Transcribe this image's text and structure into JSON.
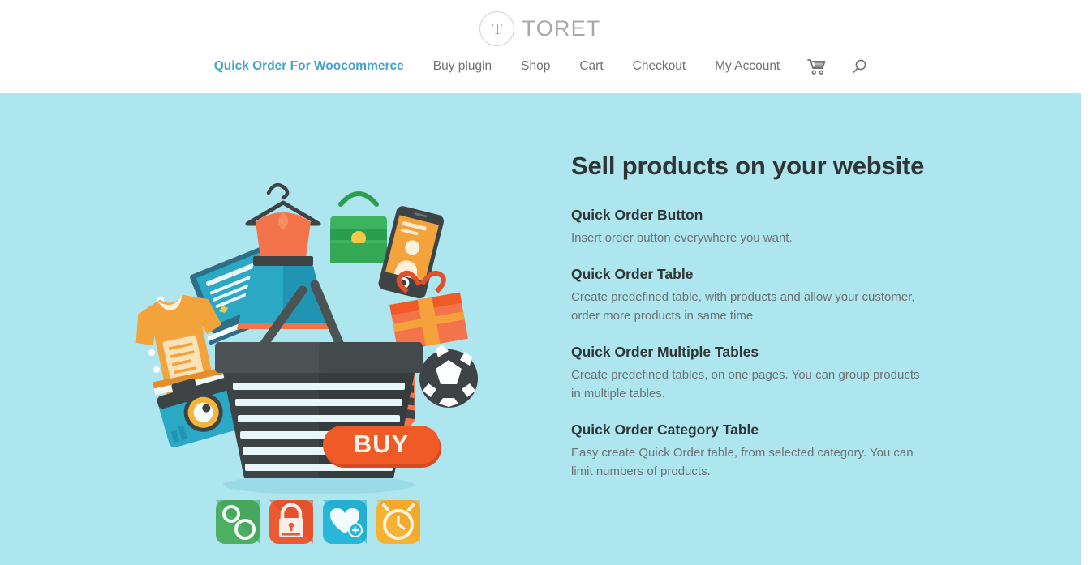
{
  "brand": {
    "mark_letter": "T",
    "name": "TORET",
    "mark_icon": "circle-t-logo-icon"
  },
  "nav": {
    "items": [
      {
        "label": "Quick Order For Woocommerce",
        "active": true
      },
      {
        "label": "Buy plugin",
        "active": false
      },
      {
        "label": "Shop",
        "active": false
      },
      {
        "label": "Cart",
        "active": false
      },
      {
        "label": "Checkout",
        "active": false
      },
      {
        "label": "My Account",
        "active": false
      }
    ],
    "icons": [
      {
        "name": "shopping-cart-icon"
      },
      {
        "name": "search-icon"
      }
    ],
    "active_color": "#49a1c9",
    "link_color": "#6e7275"
  },
  "hero": {
    "background_color": "#aee6f0",
    "title": "Sell products on your website",
    "features": [
      {
        "heading": "Quick Order Button",
        "body": "Insert order button everywhere you want."
      },
      {
        "heading": "Quick Order Table",
        "body": "Create predefined table, with products and allow your customer, order more products in same time"
      },
      {
        "heading": "Quick Order Multiple Tables",
        "body": "Create predefined tables, on one pages. You can group products in multiple tables."
      },
      {
        "heading": "Quick Order Category Table",
        "body": "Easy create Quick Order table, from selected category. You can limit numbers of products."
      }
    ],
    "illustration": {
      "name": "ecommerce-shopping-basket-illustration",
      "buy_button_label": "BUY",
      "buy_button_color": "#ef5a27",
      "basket_color": "#3e4446",
      "items": [
        "laptop-icon",
        "dress-on-hanger-icon",
        "handbag-icon",
        "smartphone-profile-icon",
        "gift-box-icon",
        "soccer-ball-icon",
        "necktie-icon",
        "tshirt-icon",
        "camera-icon"
      ],
      "app_tiles": [
        {
          "name": "settings-gears-tile-icon",
          "color": "#4caf62"
        },
        {
          "name": "padlock-tile-icon",
          "color": "#ec5a32"
        },
        {
          "name": "favorite-heart-add-tile-icon",
          "color": "#29b6d8"
        },
        {
          "name": "alarm-clock-tile-icon",
          "color": "#f7b133"
        }
      ]
    }
  },
  "colors": {
    "heading": "#2f3436",
    "body": "#6c7073",
    "hero_bg": "#aee6f0",
    "accent": "#49a1c9"
  }
}
